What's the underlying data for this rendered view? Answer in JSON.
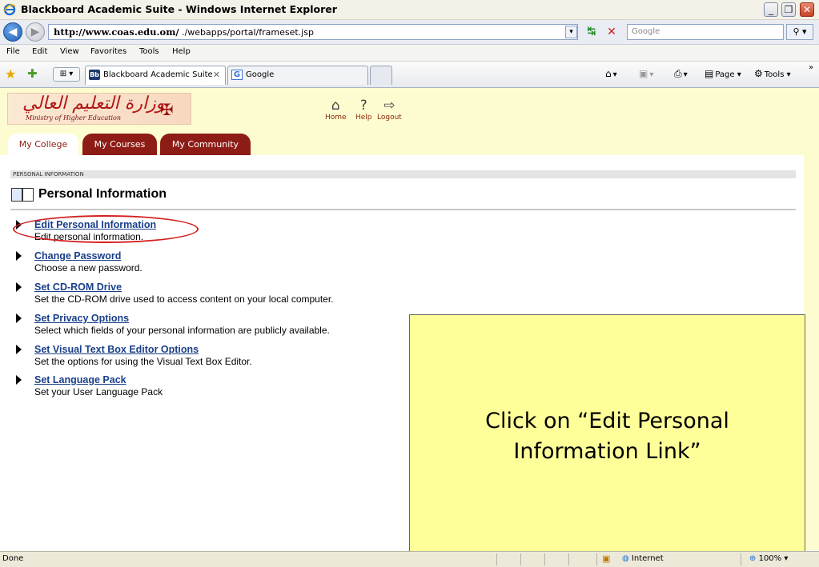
{
  "window": {
    "title": "Blackboard Academic Suite - Windows Internet Explorer",
    "min_glyph": "_",
    "max_glyph": "❐",
    "close_glyph": "✕"
  },
  "address_bar": {
    "url_host": "http://www.coas.edu.om/",
    "url_path": "  ./webapps/portal/frameset.jsp",
    "search_placeholder": "Google",
    "dropdown_glyph": "▾",
    "refresh_glyph": "↹",
    "stop_glyph": "✕",
    "search_glyph": "⚲ ▾",
    "back_glyph": "◀",
    "fwd_glyph": "▶"
  },
  "menu": [
    "File",
    "Edit",
    "View",
    "Favorites",
    "Tools",
    "Help"
  ],
  "browser_tabs": {
    "active_label": "Blackboard Academic Suite",
    "active_icon": "Bb",
    "inactive_label": "Google",
    "inactive_icon": "G",
    "close_glyph": "✕",
    "tablist_glyph": "⊞ ▾"
  },
  "commands": {
    "home": "▾",
    "feeds": "▾",
    "print": "▾",
    "page": "Page ▾",
    "tools": "Tools ▾",
    "more": "»"
  },
  "bb": {
    "logo_arabic": "وزارة التعليم العالي",
    "logo_english": "Ministry of Higher Education",
    "top_links": {
      "home": "Home",
      "help": "Help",
      "logout": "Logout"
    },
    "tabs": {
      "my_college": "My College",
      "my_courses": "My Courses",
      "my_community": "My Community"
    },
    "breadcrumb": "PERSONAL INFORMATION",
    "page_title": "Personal Information",
    "options": [
      {
        "link": "Edit Personal Information",
        "desc": "Edit personal information."
      },
      {
        "link": "Change Password",
        "desc": "Choose a new password."
      },
      {
        "link": "Set CD-ROM Drive",
        "desc": "Set the CD-ROM drive used to access content on your local computer."
      },
      {
        "link": "Set Privacy Options",
        "desc": "Select which fields of your personal information are publicly available."
      },
      {
        "link": "Set Visual Text Box Editor Options",
        "desc": "Set the options for using the Visual Text Box Editor."
      },
      {
        "link": "Set Language Pack",
        "desc": "Set your User Language Pack"
      }
    ]
  },
  "callout": {
    "text": "Click on “Edit Personal Information Link”"
  },
  "status": {
    "text": "Done",
    "zone": "Internet",
    "zoom": "100%  ▾"
  }
}
